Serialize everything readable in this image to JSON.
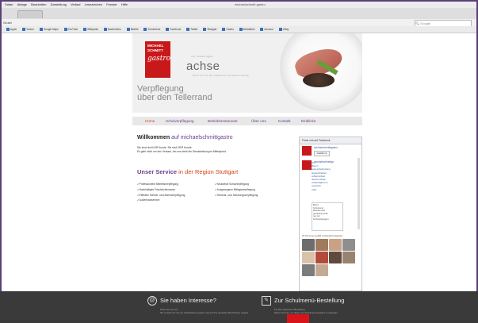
{
  "browser": {
    "window_title": "michaelschmitt gastro",
    "menu": [
      "Safari",
      "Ablage",
      "Bearbeiten",
      "Darstellung",
      "Verlauf",
      "Lesezeichen",
      "Fenster",
      "Hilfe"
    ],
    "address_label": "Grutzi",
    "search_placeholder": "Google",
    "bookmarks": [
      "Apple",
      "Yahoo!",
      "Google Maps",
      "YouTube",
      "Wikipedia",
      "Nachrichten",
      "Beliebt",
      "Schulmenü",
      "Facebook",
      "Twitter",
      "Stuttgart",
      "Gastro",
      "Mediathek",
      "Amazon",
      "eBay"
    ]
  },
  "brand": {
    "logo_line1": "MICHAEL",
    "logo_line2": "SCHMITT",
    "logo_script": "gastro",
    "partner_small": "mit unbedingter",
    "partner_name": "achse",
    "partner_sub": "Zentrum für Europäische Sozialforschung"
  },
  "hero": {
    "tagline_line1": "Verpflegung",
    "tagline_line2": "über den Tellerrand"
  },
  "nav": {
    "items": [
      "Home",
      "Schulverpflegung",
      "Betriebsrestaurant",
      "Über uns",
      "Kontakt",
      "Einblicke"
    ]
  },
  "welcome": {
    "title_strong": "Willkommen",
    "title_rest": "auf michaelschmittgastro",
    "intro_line1": "Sie sind nicht IHR Kunde. Sie sind DER Kunde.",
    "intro_line2": "Es geht nicht um den Verkauf, bei uns steht die Dienstleistung im Mittelpunkt."
  },
  "service": {
    "title_strong": "Unser Service",
    "title_rest": "in der Region Stuttgart",
    "left": [
      "Professionelle Betriebsverpflegung",
      "Nachhaltiges Frischeichkonzept",
      "Effektive Schüler- und Abendverpflegung",
      "Außerhausservice"
    ],
    "right": [
      "Neuwiesle Schulverpflegung",
      "Ausgewogene Mittagsverpflegung",
      "Seminar- und Schulungsverpflegung"
    ]
  },
  "facebook": {
    "header": "Finde uns auf Facebook",
    "page_name": "michaelschmittgastro",
    "like_label": "Gefällt mir",
    "poster": "michaelschmittga",
    "post_text": "stro\nBiss in\nwww.schulmeilung\nangeschrieben,\nschwimmbad\nderzeit stehen\nvollwertigkeit zu\nerreichen\nmitte",
    "inner_text": "Bistro\nSchulmenü\nBestellmodul\nganzjährig  2016\nneu mit\nFrühstückstage  k",
    "count_text": "23 Personen gefällt michaelschmittgastro."
  },
  "footer": {
    "left_title": "Sie haben Interesse?",
    "left_text": "Rufen Sie uns an!\nWir erstellen für Sie ein individuelles Angebot, das auf Ihre speziellen Bedürfnisse eingeht.",
    "right_title": "Zur Schulmenü-Bestellung",
    "right_text": "Für Ihre Schulmenü Bestellung\nklicken Sie hier, um direkt zum Schulmenü-Angebot zu gelangen."
  },
  "colors": {
    "brand_red": "#c9181a",
    "accent_purple": "#6a3f8a",
    "accent_orange": "#d24418",
    "footer_bg": "#3a3a3a"
  }
}
